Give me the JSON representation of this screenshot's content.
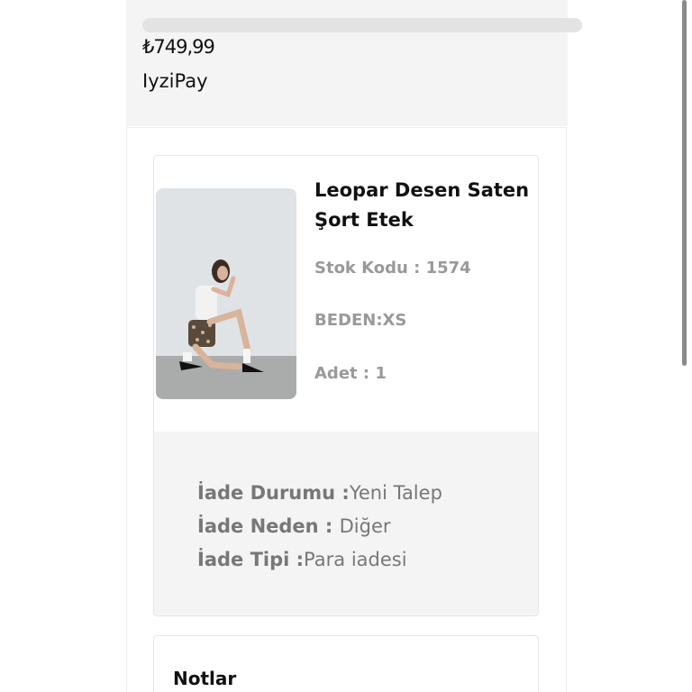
{
  "order": {
    "price": "₺749,99",
    "payment_method": "IyziPay"
  },
  "product": {
    "title": "Leopar Desen Saten Şort Etek",
    "sku": "Stok Kodu : 1574",
    "size": "BEDEN:XS",
    "quantity": "Adet : 1",
    "image_icon": "product-photo"
  },
  "return_info": {
    "status_label": "İade Durumu :",
    "status_value": "Yeni Talep",
    "reason_label": "İade Neden : ",
    "reason_value": "Diğer",
    "type_label": "İade Tipi :",
    "type_value": "Para iadesi"
  },
  "notes": {
    "title": "Notlar"
  },
  "colors": {
    "panel_bg": "#f4f4f4",
    "text_primary": "#111111",
    "text_muted": "#999999",
    "return_text": "#777777"
  }
}
